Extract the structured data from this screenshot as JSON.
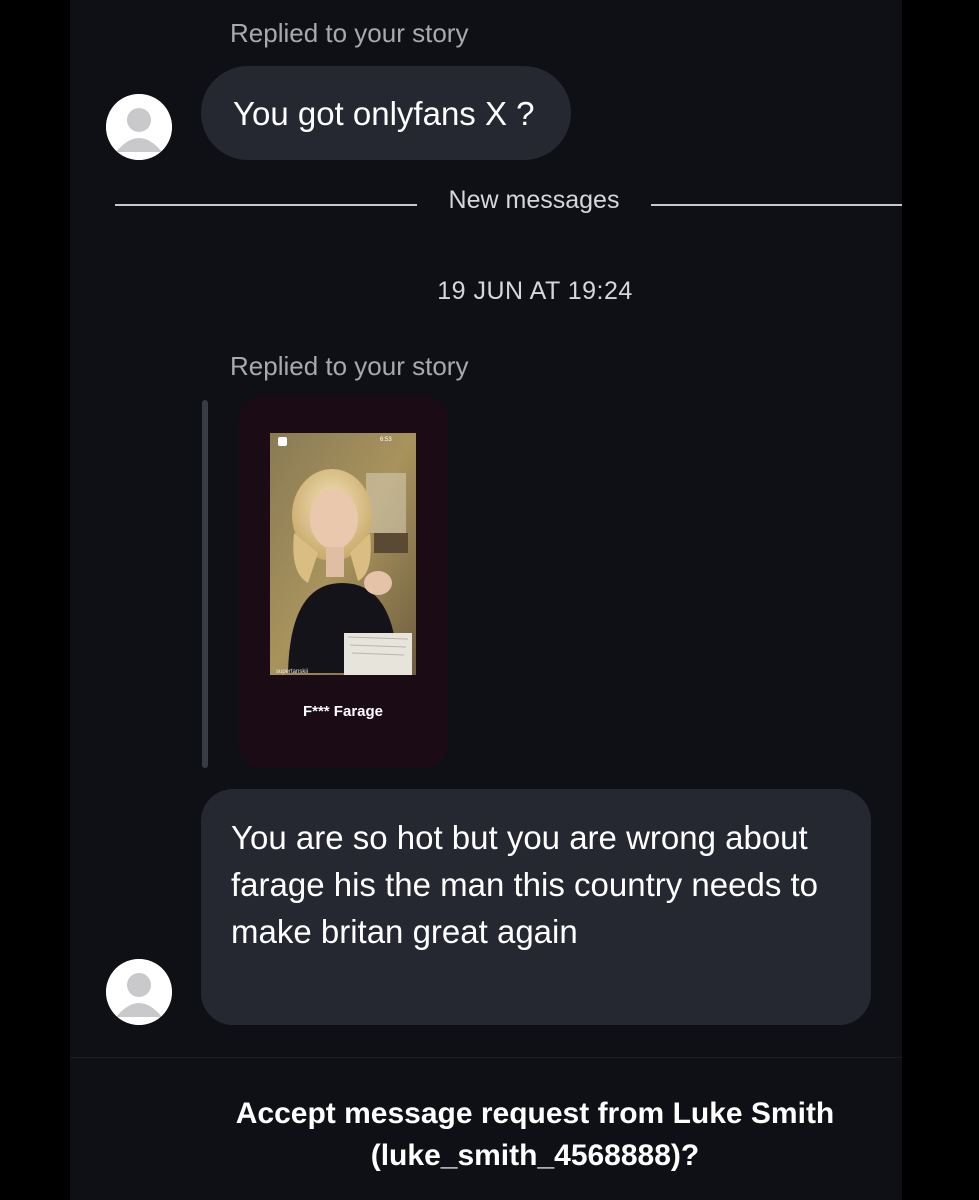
{
  "thread": {
    "first": {
      "reply_label": "Replied to your story",
      "message": "You got onlyfans X ?"
    },
    "divider_label": "New messages",
    "timestamp": "19 JUN AT 19:24",
    "second": {
      "reply_label": "Replied to your story",
      "story": {
        "status_time": "6:53",
        "username": "supertanskii",
        "caption": "F*** Farage"
      },
      "message": "You are so hot but you are wrong about farage his the man this country needs to make britan great again"
    }
  },
  "request": {
    "line1": "Accept message request from Luke Smith",
    "line2": "(luke_smith_4568888)?"
  },
  "icons": {
    "avatar": "default-profile-icon",
    "lock": "lock-icon"
  },
  "colors": {
    "background": "#000000",
    "screen": "#0f1015",
    "bubble": "#262831",
    "secondary_text": "#a8a9ae"
  }
}
